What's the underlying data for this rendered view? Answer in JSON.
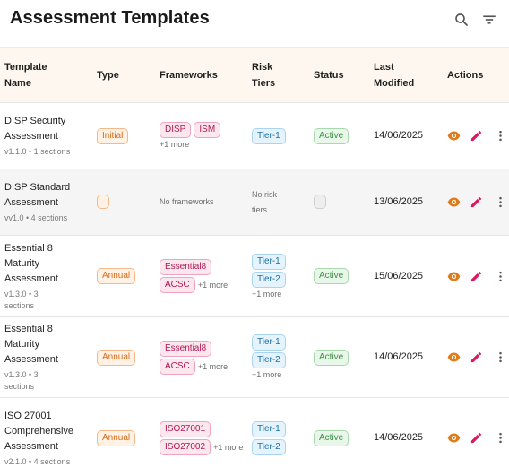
{
  "header": {
    "title": "Assessment Templates",
    "search_icon": "search-icon",
    "filter_icon": "filter-icon"
  },
  "table": {
    "columns": [
      "Template Name",
      "Type",
      "Frameworks",
      "Risk Tiers",
      "Status",
      "Last Modified",
      "Actions"
    ],
    "rows": [
      {
        "name": "DISP Security Assessment",
        "meta": "v1.1.0 • 1 sections",
        "type": "Initial",
        "frameworks": [
          "DISP",
          "ISM"
        ],
        "frameworks_more": "+1 more",
        "risk_tiers": [
          "Tier-1"
        ],
        "risk_more": "",
        "status": "Active",
        "modified": "14/06/2025"
      },
      {
        "name": "DISP Standard Assessment",
        "meta": "vv1.0 • 4 sections",
        "type": "",
        "frameworks_empty": "No frameworks",
        "risk_empty": "No risk tiers",
        "status": "",
        "modified": "13/06/2025"
      },
      {
        "name": "Essential 8 Maturity Assessment",
        "meta": "v1.3.0 • 3 sections",
        "type": "Annual",
        "frameworks": [
          "Essential8",
          "ACSC"
        ],
        "frameworks_more": "+1 more",
        "risk_tiers": [
          "Tier-1",
          "Tier-2"
        ],
        "risk_more": "+1 more",
        "status": "Active",
        "modified": "15/06/2025"
      },
      {
        "name": "Essential 8 Maturity Assessment",
        "meta": "v1.3.0 • 3 sections",
        "type": "Annual",
        "frameworks": [
          "Essential8",
          "ACSC"
        ],
        "frameworks_more": "+1 more",
        "risk_tiers": [
          "Tier-1",
          "Tier-2"
        ],
        "risk_more": "+1 more",
        "status": "Active",
        "modified": "14/06/2025"
      },
      {
        "name": "ISO 27001 Comprehensive Assessment",
        "meta": "v2.1.0 • 4 sections",
        "type": "Annual",
        "frameworks": [
          "ISO27001",
          "ISO27002"
        ],
        "frameworks_more": "+1 more",
        "risk_tiers": [
          "Tier-1",
          "Tier-2"
        ],
        "risk_more": "",
        "status": "Active",
        "modified": "14/06/2025"
      }
    ],
    "action_icons": [
      "view-icon",
      "edit-icon",
      "more-options-icon"
    ]
  },
  "colors": {
    "header_bg": "#fdf7ef",
    "type_chip": "#d86b1a",
    "framework_chip": "#b0174f",
    "tier_chip": "#1d6fa5",
    "status_active": "#3d8f42",
    "view_icon": "#e07b1a",
    "edit_icon": "#d81b60"
  }
}
